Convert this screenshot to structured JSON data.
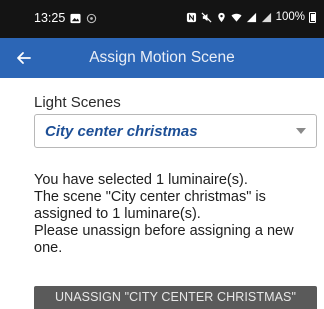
{
  "status_bar": {
    "time": "13:25",
    "battery": "100%",
    "icons": [
      "image-icon",
      "circle-icon",
      "nfc-icon",
      "mute-icon",
      "location-icon",
      "wifi-icon",
      "signal-icon",
      "signal-icon",
      "battery-icon"
    ]
  },
  "app_bar": {
    "title": "Assign Motion Scene",
    "back_icon": "arrow-left-icon",
    "background_color": "#2c66b6"
  },
  "light_scenes": {
    "label": "Light Scenes",
    "selected": "City center christmas",
    "selected_color": "#1d4f96",
    "dropdown_icon": "caret-down-icon"
  },
  "message": {
    "lines": [
      "You have selected 1 luminaire(s).",
      "The scene \"City center christmas\" is",
      "assigned to 1 luminare(s).",
      "Please unassign before assigning a new",
      "one."
    ]
  },
  "actions": {
    "unassign_label": "UNASSIGN \"CITY CENTER CHRISTMAS\"",
    "unassign_color": "#5a5a5a"
  }
}
